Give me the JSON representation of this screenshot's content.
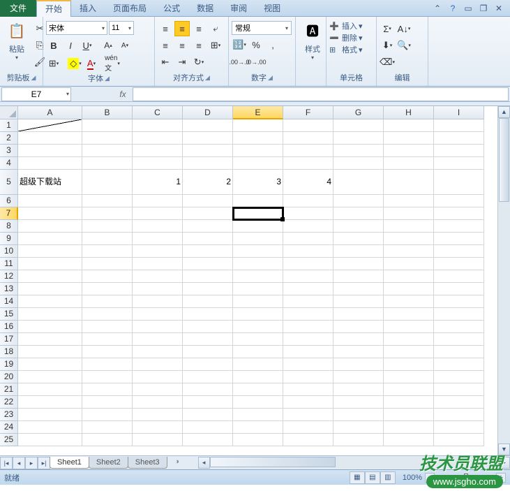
{
  "tabs": {
    "file": "文件",
    "home": "开始",
    "insert": "插入",
    "pageLayout": "页面布局",
    "formulas": "公式",
    "data": "数据",
    "review": "审阅",
    "view": "视图"
  },
  "ribbon": {
    "clipboard": {
      "label": "剪贴板",
      "paste": "粘贴"
    },
    "font": {
      "label": "字体",
      "name": "宋体",
      "size": "11"
    },
    "alignment": {
      "label": "对齐方式"
    },
    "number": {
      "label": "数字",
      "format": "常规"
    },
    "styles": {
      "label": "样式",
      "btn": "样式"
    },
    "cells": {
      "label": "单元格",
      "insert": "插入",
      "delete": "删除",
      "format": "格式"
    },
    "editing": {
      "label": "编辑"
    }
  },
  "nameBox": "E7",
  "fx": "fx",
  "columns": [
    "A",
    "B",
    "C",
    "D",
    "E",
    "F",
    "G",
    "H",
    "I"
  ],
  "rows": [
    "1",
    "2",
    "3",
    "4",
    "5",
    "6",
    "7",
    "8",
    "9",
    "10",
    "11",
    "12",
    "13",
    "14",
    "15",
    "16",
    "17",
    "18",
    "19",
    "20",
    "21",
    "22",
    "23",
    "24",
    "25"
  ],
  "activeCol": "E",
  "activeRow": "7",
  "cells": {
    "A5": "超级下载站",
    "C5": "1",
    "D5": "2",
    "E5": "3",
    "F5": "4"
  },
  "sheets": {
    "s1": "Sheet1",
    "s2": "Sheet2",
    "s3": "Sheet3"
  },
  "status": "就绪",
  "zoom": "100%",
  "watermark": {
    "text": "技术员联盟",
    "url": "www.jsgho.com"
  }
}
